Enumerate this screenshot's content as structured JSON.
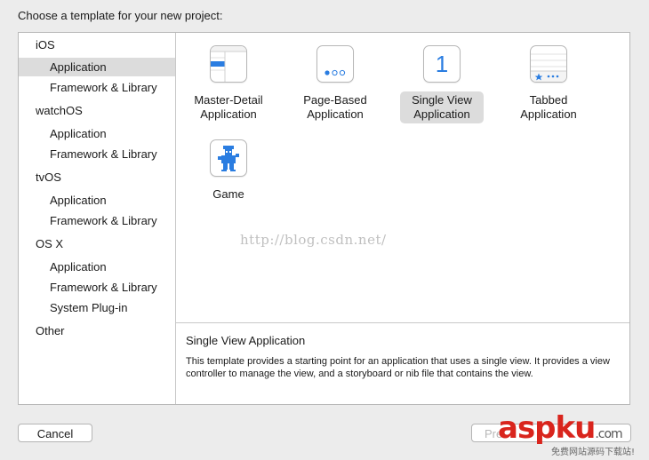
{
  "header": {
    "title": "Choose a template for your new project:"
  },
  "sidebar": {
    "items": [
      {
        "label": "iOS",
        "kind": "platform"
      },
      {
        "label": "Application",
        "kind": "sub",
        "selected": true
      },
      {
        "label": "Framework & Library",
        "kind": "sub"
      },
      {
        "label": "watchOS",
        "kind": "platform"
      },
      {
        "label": "Application",
        "kind": "sub"
      },
      {
        "label": "Framework & Library",
        "kind": "sub"
      },
      {
        "label": "tvOS",
        "kind": "platform"
      },
      {
        "label": "Application",
        "kind": "sub"
      },
      {
        "label": "Framework & Library",
        "kind": "sub"
      },
      {
        "label": "OS X",
        "kind": "platform"
      },
      {
        "label": "Application",
        "kind": "sub"
      },
      {
        "label": "Framework & Library",
        "kind": "sub"
      },
      {
        "label": "System Plug-in",
        "kind": "sub"
      },
      {
        "label": "Other",
        "kind": "platform"
      }
    ]
  },
  "templates": [
    {
      "line1": "Master-Detail",
      "line2": "Application",
      "icon": "master-detail-icon"
    },
    {
      "line1": "Page-Based",
      "line2": "Application",
      "icon": "page-based-icon"
    },
    {
      "line1": "Single View",
      "line2": "Application",
      "icon": "single-view-icon",
      "icon_text": "1",
      "selected": true
    },
    {
      "line1": "Tabbed",
      "line2": "Application",
      "icon": "tabbed-icon"
    },
    {
      "line1": "Game",
      "line2": "",
      "icon": "game-icon"
    }
  ],
  "description": {
    "title": "Single View Application",
    "text": "This template provides a starting point for an application that uses a single view. It provides a view controller to manage the view, and a storyboard or nib file that contains the view."
  },
  "buttons": {
    "cancel": "Cancel",
    "next": "Pre"
  },
  "watermark": {
    "url": "http://blog.csdn.net/",
    "logo": "aspku",
    "logo_suffix": ".com",
    "sub": "免费网站源码下载站!"
  },
  "colors": {
    "accent": "#2a7de1",
    "selection": "#dcdcdc",
    "logo_red": "#d9251d"
  }
}
